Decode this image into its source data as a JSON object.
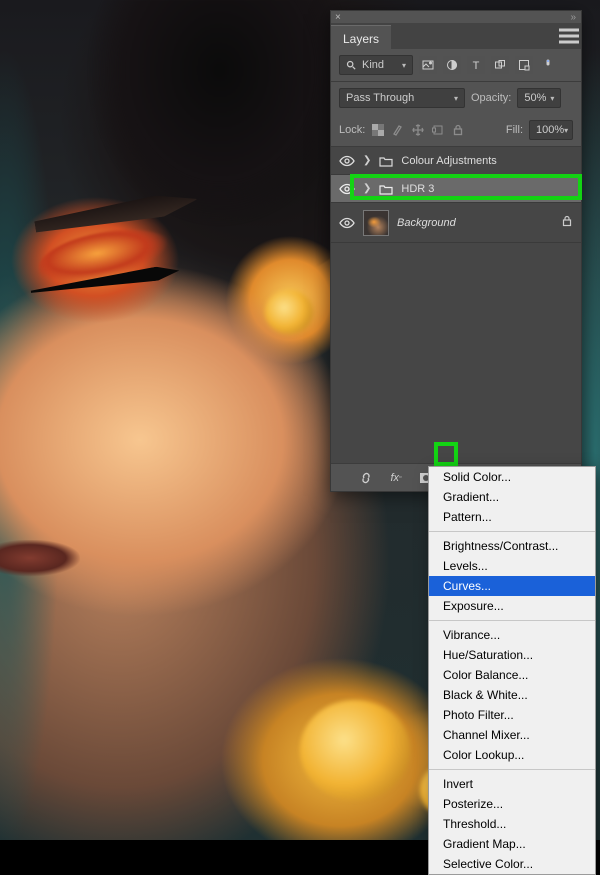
{
  "panel": {
    "tab": "Layers",
    "filter": {
      "label": "Kind"
    },
    "type_icons": [
      "image",
      "adjustment",
      "type",
      "shape",
      "smartobject",
      "dot"
    ],
    "blend_mode": "Pass Through",
    "opacity": {
      "label": "Opacity:",
      "value": "50%"
    },
    "lock": {
      "label": "Lock:"
    },
    "fill": {
      "label": "Fill:",
      "value": "100%"
    },
    "layers": [
      {
        "name": "Colour Adjustments",
        "kind": "group",
        "visible": true
      },
      {
        "name": "HDR 3",
        "kind": "group",
        "visible": true,
        "selected": true
      },
      {
        "name": "Background",
        "kind": "pixel",
        "visible": true,
        "locked": true
      }
    ],
    "footer_icons": [
      "link",
      "fx",
      "mask",
      "adjustment",
      "group",
      "new",
      "trash"
    ]
  },
  "menu": {
    "groups": [
      [
        "Solid Color...",
        "Gradient...",
        "Pattern..."
      ],
      [
        "Brightness/Contrast...",
        "Levels...",
        "Curves...",
        "Exposure..."
      ],
      [
        "Vibrance...",
        "Hue/Saturation...",
        "Color Balance...",
        "Black & White...",
        "Photo Filter...",
        "Channel Mixer...",
        "Color Lookup..."
      ],
      [
        "Invert",
        "Posterize...",
        "Threshold...",
        "Gradient Map...",
        "Selective Color..."
      ]
    ],
    "selected": "Curves..."
  }
}
